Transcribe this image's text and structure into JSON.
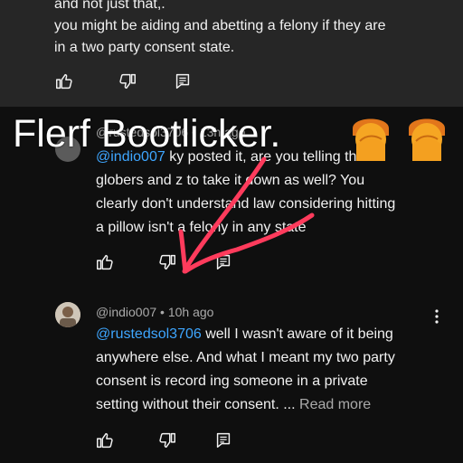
{
  "top_comment": {
    "line1": "and not just that,.",
    "line2": "you might be aiding and abetting a felony if they are",
    "line3": "in a two party consent state."
  },
  "reply1": {
    "meta": "@rustedsol3706 • 13h ago",
    "mention": "@indio007",
    "line1_rest": " ky posted it, are you telling the",
    "line2": "globers and z to take it down as well? You",
    "line3": "clearly don't understand law considering hitting",
    "line4": "a pillow isn't a felony in any state"
  },
  "reply2": {
    "meta": "@indio007 • 10h ago",
    "mention": "@rustedsol3706",
    "line1_rest": " well I wasn't aware of it being",
    "line2": "anywhere else. And what I meant my two party",
    "line3": "consent is record ing someone in a private",
    "line4_start": "setting without their consent. ... ",
    "read_more": "Read more"
  },
  "overlay": {
    "title": "Flerf Bootlicker.",
    "emoji_name": "person-facepalming-icon",
    "arrow_color": "#ff3b5c"
  },
  "colors": {
    "background": "#0f0f0f",
    "top_card": "#262626",
    "mention": "#3ea6ff",
    "meta": "#aaaaaa"
  }
}
